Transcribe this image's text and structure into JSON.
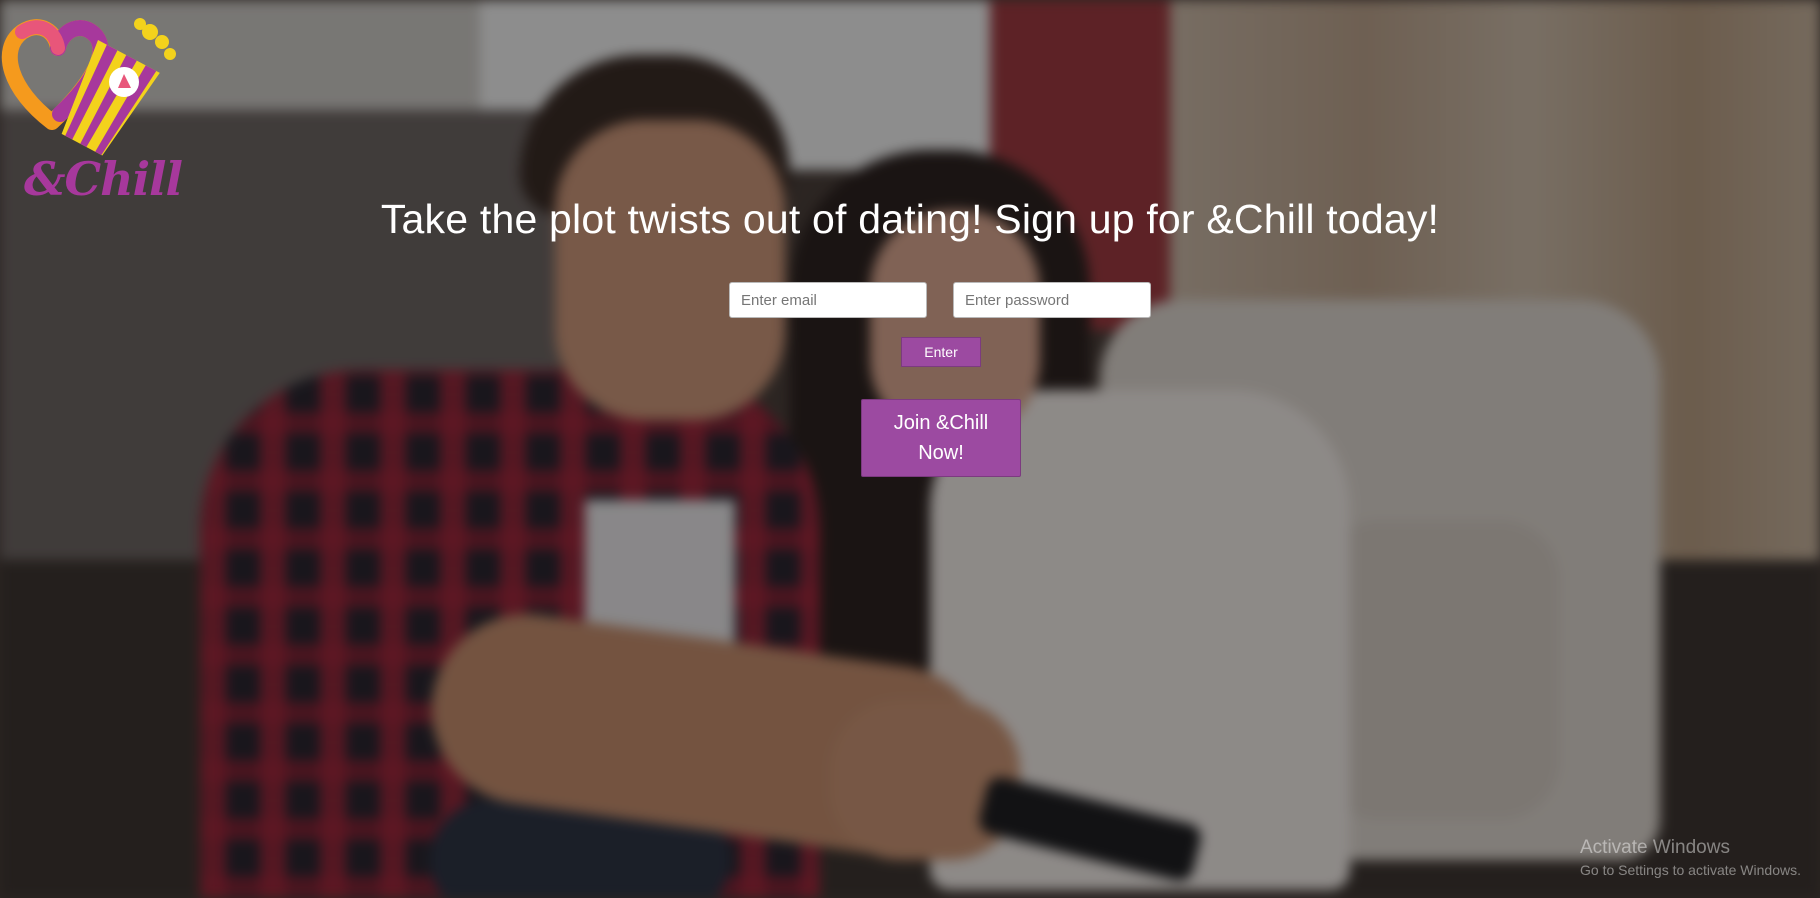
{
  "brand": {
    "logo_text": "&Chill",
    "colors": {
      "purple": "#a7389c",
      "orange": "#f59a1d",
      "yellow": "#f3d21c",
      "button": "#9c4aa1"
    }
  },
  "hero": {
    "headline": "Take the plot twists out of dating! Sign up for &Chill today!"
  },
  "login_form": {
    "email_placeholder": "Enter email",
    "password_placeholder": "Enter password",
    "submit_label": "Enter"
  },
  "cta": {
    "join_label": "Join &Chill Now!"
  },
  "os_watermark": {
    "title": "Activate Windows",
    "subtitle": "Go to Settings to activate Windows."
  },
  "background": {
    "description_icon": "couple-watching-tv-photo"
  }
}
